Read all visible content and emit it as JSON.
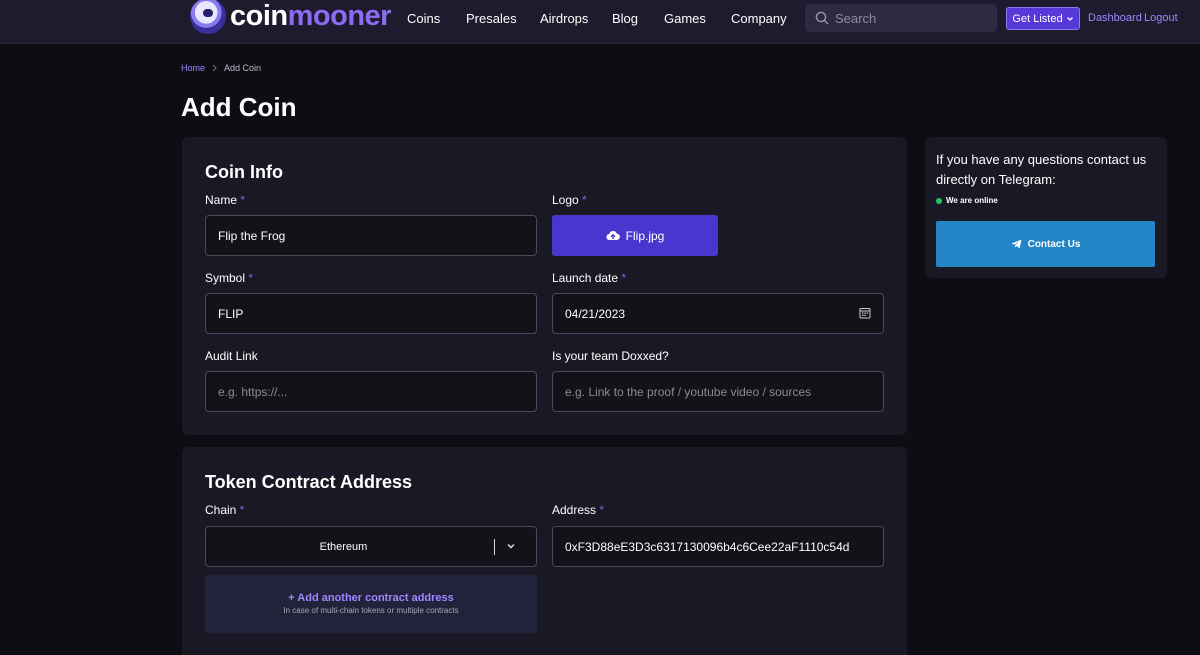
{
  "header": {
    "logo_text_a": "coin",
    "logo_text_b": "mooner",
    "nav": [
      {
        "label": "Coins"
      },
      {
        "label": "Presales"
      },
      {
        "label": "Airdrops"
      },
      {
        "label": "Blog"
      },
      {
        "label": "Games"
      },
      {
        "label": "Company"
      }
    ],
    "search_placeholder": "Search",
    "get_listed_label": "Get Listed",
    "dashboard_label": "Dashboard",
    "logout_label": "Logout"
  },
  "breadcrumb": {
    "home": "Home",
    "current": "Add Coin"
  },
  "page_title": "Add Coin",
  "coin_info": {
    "title": "Coin Info",
    "name": {
      "label": "Name",
      "required": "*",
      "value": "Flip the Frog"
    },
    "logo": {
      "label": "Logo",
      "required": "*",
      "file": "Flip.jpg"
    },
    "symbol": {
      "label": "Symbol",
      "required": "*",
      "value": "FLIP"
    },
    "launch_date": {
      "label": "Launch date",
      "required": "*",
      "value": "04/21/2023"
    },
    "audit_link": {
      "label": "Audit Link",
      "placeholder": "e.g. https://..."
    },
    "doxxed": {
      "label": "Is your team Doxxed?",
      "placeholder": "e.g. Link to the proof / youtube video / sources"
    }
  },
  "token_contract": {
    "title": "Token Contract Address",
    "chain": {
      "label": "Chain",
      "required": "*",
      "value": "Ethereum"
    },
    "address": {
      "label": "Address",
      "required": "*",
      "value": "0xF3D88eE3D3c6317130096b4c6Cee22aF1110c54d"
    },
    "add_another": "+ Add another contract address",
    "add_note": "In case of multi-chain tokens or multiple contracts"
  },
  "side": {
    "text": "If you have any questions contact us directly on Telegram:",
    "online": "We are online",
    "contact_label": "Contact Us"
  },
  "colors": {
    "accent": "#5639d8",
    "link": "#9d88ff",
    "telegram": "#2385c6",
    "online": "#22c55e"
  }
}
